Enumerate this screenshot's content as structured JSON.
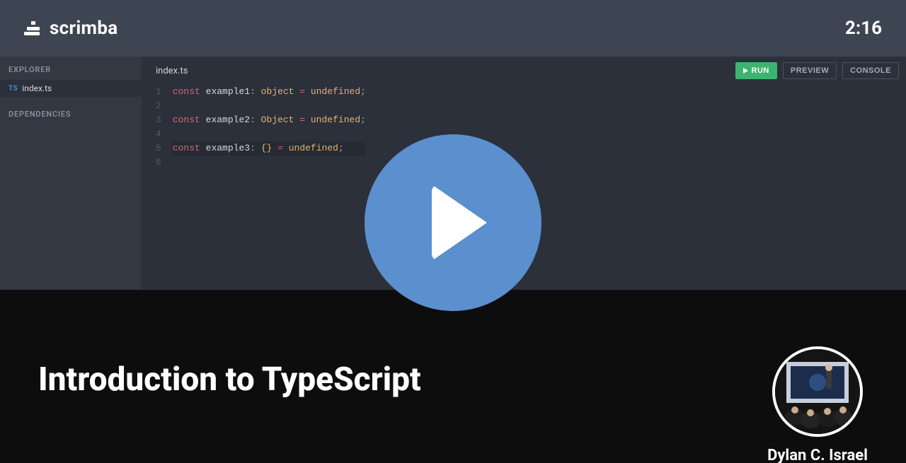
{
  "header": {
    "brand": "scrimba",
    "timestamp": "2:16"
  },
  "sidebar": {
    "explorer_label": "EXPLORER",
    "dependencies_label": "DEPENDENCIES",
    "files": [
      {
        "lang": "TS",
        "name": "index.ts"
      }
    ]
  },
  "editor": {
    "active_tab": "index.ts",
    "toolbar": {
      "run_label": "RUN",
      "preview_label": "PREVIEW",
      "console_label": "CONSOLE"
    },
    "code": {
      "lines": [
        {
          "n": "1",
          "tokens": [
            [
              "kw",
              "const"
            ],
            [
              "sp",
              " "
            ],
            [
              "id",
              "example1"
            ],
            [
              "punct",
              ": "
            ],
            [
              "type",
              "object"
            ],
            [
              "sp",
              " "
            ],
            [
              "assign",
              "="
            ],
            [
              "sp",
              " "
            ],
            [
              "val",
              "undefined"
            ],
            [
              "punct",
              ";"
            ]
          ]
        },
        {
          "n": "2",
          "tokens": []
        },
        {
          "n": "3",
          "tokens": [
            [
              "kw",
              "const"
            ],
            [
              "sp",
              " "
            ],
            [
              "id",
              "example2"
            ],
            [
              "punct",
              ": "
            ],
            [
              "type",
              "Object"
            ],
            [
              "sp",
              " "
            ],
            [
              "assign",
              "="
            ],
            [
              "sp",
              " "
            ],
            [
              "val",
              "undefined"
            ],
            [
              "punct",
              ";"
            ]
          ]
        },
        {
          "n": "4",
          "tokens": []
        },
        {
          "n": "5",
          "tokens": [
            [
              "kw",
              "const"
            ],
            [
              "sp",
              " "
            ],
            [
              "id",
              "example3"
            ],
            [
              "punct",
              ": "
            ],
            [
              "type",
              "{}"
            ],
            [
              "sp",
              " "
            ],
            [
              "assign",
              "="
            ],
            [
              "sp",
              " "
            ],
            [
              "val",
              "undefined"
            ],
            [
              "punct",
              ";"
            ]
          ],
          "active": true
        },
        {
          "n": "6",
          "tokens": []
        }
      ]
    }
  },
  "footer": {
    "course_title": "Introduction to TypeScript",
    "instructor_name": "Dylan C. Israel"
  }
}
